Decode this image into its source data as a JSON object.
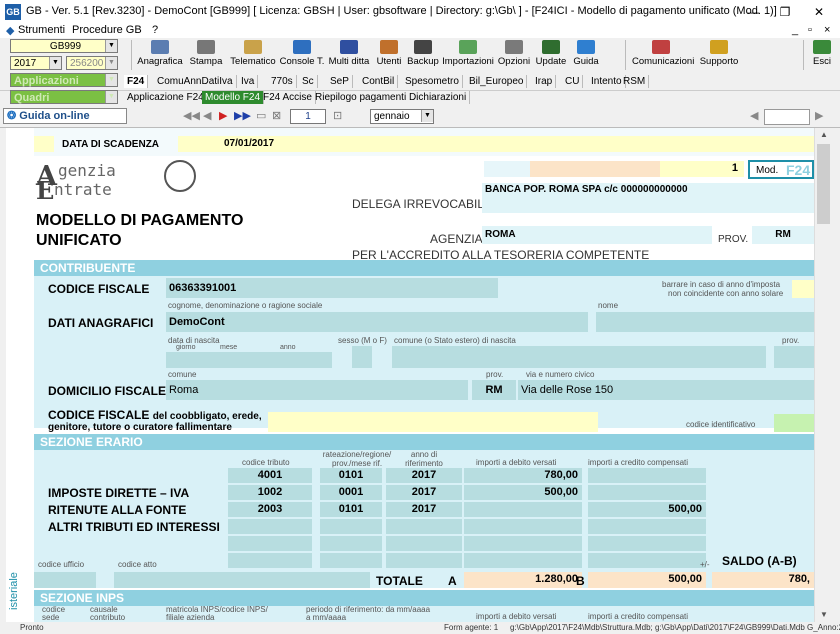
{
  "title_bar": {
    "text": "GB - Ver. 5.1 [Rev.3230] -  DemoCont [GB999]    [ Licenza: GBSH | User: gbsoftware | Directory: g:\\Gb\\ ] - [F24ICI - Modello di pagamento unificato (Mod. 1)]",
    "logo": "GB",
    "minimize": "—",
    "restore": "❐",
    "close": "✕"
  },
  "menu": {
    "icon": "◆",
    "items": [
      "Strumenti",
      "Procedure GB",
      "?"
    ],
    "mdi": {
      "min": "_",
      "restore": "▫",
      "close": "×"
    }
  },
  "selectors": {
    "company": "GB999",
    "year": "2017",
    "code": "256200 -",
    "applicazioni": "Applicazioni",
    "quadri": "Quadri"
  },
  "toolbar": {
    "buttons": [
      {
        "label": "Anagrafica",
        "icon": "anagrafica-icon",
        "color": "#5b7db1"
      },
      {
        "label": "Stampa",
        "icon": "printer-icon",
        "color": "#777777"
      },
      {
        "label": "Telematico",
        "icon": "telematico-icon",
        "color": "#c9a24a"
      },
      {
        "label": "Console T.",
        "icon": "console-icon",
        "color": "#2e6fbf"
      },
      {
        "label": "Multi ditta",
        "icon": "multi-ditta-icon",
        "color": "#2f4fa0"
      },
      {
        "label": "Utenti",
        "icon": "users-icon",
        "color": "#c0702c"
      },
      {
        "label": "Backup",
        "icon": "backup-icon",
        "color": "#444444"
      },
      {
        "label": "Importazioni",
        "icon": "import-icon",
        "color": "#5aa35a"
      },
      {
        "label": "Opzioni",
        "icon": "options-icon",
        "color": "#7a7a7a"
      },
      {
        "label": "Update",
        "icon": "update-icon",
        "color": "#2f6d2f"
      },
      {
        "label": "Guida",
        "icon": "help-icon",
        "color": "#2f7fd0"
      },
      {
        "label": "Comunicazioni",
        "icon": "comunicazioni-icon",
        "color": "#c04040"
      },
      {
        "label": "Supporto",
        "icon": "support-icon",
        "color": "#d0a020"
      },
      {
        "label": "Esci",
        "icon": "exit-icon",
        "color": "#3a8a3a"
      }
    ]
  },
  "tabs_row1": [
    "F24",
    "ComuAnnDatiIva",
    "Iva",
    "770s",
    "Sc",
    "SeP",
    "ContBil",
    "Spesometro",
    "Bil_Europeo",
    "Irap",
    "CU",
    "Intento",
    "RSM"
  ],
  "tabs_row2": [
    "Applicazione F24",
    "Modello F24",
    "F24 Accise",
    "Riepilogo pagamenti Dichiarazioni"
  ],
  "tabs_row2_active": "Modello F24",
  "nav": {
    "guida": "Guida on-line",
    "page": "1",
    "month": "gennaio"
  },
  "form": {
    "data_scadenza_label": "DATA DI SCADENZA",
    "data_scadenza": "07/01/2017",
    "logo_text1": "genzia",
    "logo_text2": "ntrate",
    "logo_letter1": "A",
    "logo_letter2": "E",
    "mod_number": "1",
    "mod_label": "Mod.",
    "mod_code": "F24",
    "title1": "MODELLO DI PAGAMENTO",
    "title2": "UNIFICATO",
    "delega": "DELEGA IRREVOCABILE A:",
    "banca": "BANCA POP. ROMA SPA c/c 000000000000",
    "agenzia_label": "AGENZIA",
    "agenzia": "ROMA",
    "prov_label": "PROV.",
    "prov": "RM",
    "accredito": "PER L'ACCREDITO ALLA TESORERIA COMPETENTE",
    "contribuente": "CONTRIBUENTE",
    "codice_fiscale_label": "CODICE FISCALE",
    "codice_fiscale": "06363391001",
    "barrare": "barrare in caso di anno d'imposta",
    "barrare2": "non coincidente con anno solare",
    "cognome_label": "cognome, denominazione o ragione sociale",
    "nome_label": "nome",
    "dati_anagrafici": "DATI ANAGRAFICI",
    "denominazione": "DemoCont",
    "data_nascita_label": "data di nascita",
    "giorno": "giorno",
    "mese": "mese",
    "anno": "anno",
    "sesso_label": "sesso (M o F)",
    "comune_nascita_label": "comune (o Stato estero) di nascita",
    "prov_small": "prov.",
    "comune_label": "comune",
    "via_label": "via e numero civico",
    "domicilio": "DOMICILIO FISCALE",
    "comune": "Roma",
    "prov_dom": "RM",
    "via": "Via delle Rose 150",
    "coobbligato1": "CODICE FISCALE",
    "coobbligato1b": "del coobbligato, erede,",
    "coobbligato2": "genitore, tutore o curatore fallimentare",
    "codice_identificativo": "codice identificativo",
    "sezione_erario": "SEZIONE ERARIO",
    "col_codice_tributo": "codice tributo",
    "col_rateazione": "rateazione/regione/ prov./mese rif.",
    "col_anno": "anno di riferimento",
    "col_debito": "importi a debito versati",
    "col_credito": "importi a credito compensati",
    "imposte_dirette": "IMPOSTE DIRETTE – IVA",
    "ritenute": "RITENUTE ALLA FONTE",
    "altri": "ALTRI TRIBUTI ED INTERESSI",
    "rows": [
      {
        "codice": "4001",
        "rateazione": "0101",
        "anno": "2017",
        "debito": "780,00",
        "credito": ""
      },
      {
        "codice": "1002",
        "rateazione": "0001",
        "anno": "2017",
        "debito": "500,00",
        "credito": ""
      },
      {
        "codice": "2003",
        "rateazione": "0101",
        "anno": "2017",
        "debito": "",
        "credito": "500,00"
      }
    ],
    "codice_ufficio": "codice ufficio",
    "codice_atto": "codice atto",
    "totale": "TOTALE",
    "totale_a_label": "A",
    "totale_a": "1.280,00",
    "totale_b_label": "B",
    "totale_b": "500,00",
    "saldo_label": "SALDO (A-B)",
    "saldo_plus": "+/-",
    "saldo": "780,",
    "side_text": "isteriale",
    "sezione_inps": "SEZIONE INPS",
    "inps_codice_sede": "codice sede",
    "inps_causale": "causale contributo",
    "inps_matricola": "matricola INPS/codice INPS/ filiale azienda",
    "inps_periodo": "periodo di riferimento: da mm/aaaa   a mm/aaaa",
    "inps_debito": "importi a debito versati",
    "inps_credito": "importi a credito compensati"
  },
  "status": {
    "left": "Pronto",
    "form": "Form agente: 1",
    "path": "g:\\Gb\\App\\2017\\F24\\Mdb\\Struttura.Mdb; g:\\Gb\\App\\Dati\\2017\\F24\\GB999\\Dati.Mdb G_Anno:2"
  },
  "colors": {
    "field": "#b7dde0",
    "section": "#8fd0e0",
    "bg": "#d9f1f7",
    "yellow": "#ffffc8",
    "peach": "#fce4c8",
    "green": "#7bc043",
    "teal_dark": "#1e8fa8"
  }
}
